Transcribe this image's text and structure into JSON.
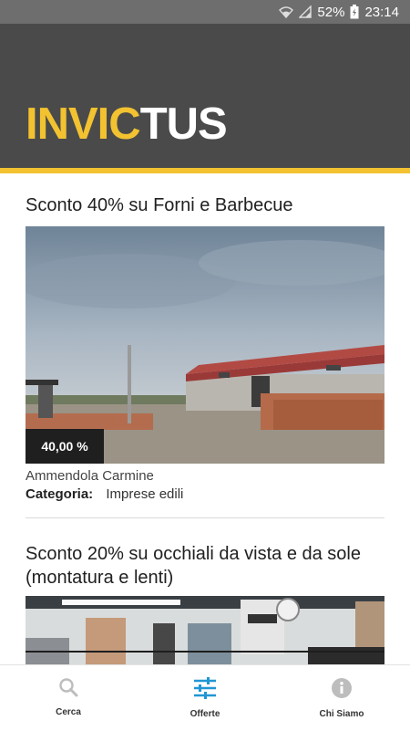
{
  "status_bar": {
    "battery": "52%",
    "time": "23:14"
  },
  "brand": {
    "logo_part1": "INVIC",
    "logo_part2": "TUS",
    "accent_color": "#f2c230",
    "header_color": "#4a4a4a"
  },
  "offers": [
    {
      "title": "Sconto 40% su Forni e Barbecue",
      "discount_badge": "40,00 %",
      "company": "Ammendola Carmine",
      "category_label": "Categoria:",
      "category_value": "Imprese edili"
    },
    {
      "title": "Sconto 20% su occhiali da vista e da sole (montatura e lenti)"
    }
  ],
  "bottom_nav": [
    {
      "label": "Cerca",
      "icon": "search-icon",
      "active": false
    },
    {
      "label": "Offerte",
      "icon": "sliders-icon",
      "active": true
    },
    {
      "label": "Chi Siamo",
      "icon": "info-icon",
      "active": false
    }
  ],
  "colors": {
    "nav_active": "#2196d3",
    "nav_inactive": "#bdbdbd"
  }
}
